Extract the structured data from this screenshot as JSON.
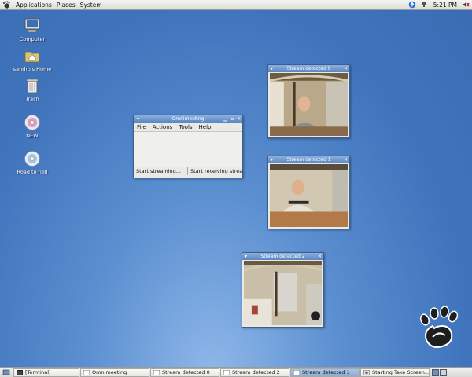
{
  "top_panel": {
    "menus": [
      "Applications",
      "Places",
      "System"
    ],
    "clock": "5:21 PM"
  },
  "desktop_icons": [
    {
      "label": "Computer"
    },
    {
      "label": "sandro's Home"
    },
    {
      "label": "Trash"
    },
    {
      "label": "NEW"
    },
    {
      "label": "Road to hell"
    }
  ],
  "omnimeeting": {
    "title": "Omnimeeting",
    "menus": [
      "File",
      "Actions",
      "Tools",
      "Help"
    ],
    "status_left": "Start streaming...",
    "status_right": "Start receiving stream"
  },
  "streams": [
    {
      "title": "Stream detected 0"
    },
    {
      "title": "Stream detected 1"
    },
    {
      "title": "Stream detected 2"
    }
  ],
  "taskbar": {
    "items": [
      {
        "label": "[Terminal]",
        "active": false
      },
      {
        "label": "Omnimeeting",
        "active": false
      },
      {
        "label": "Stream detected 0",
        "active": false
      },
      {
        "label": "Stream detected 2",
        "active": false
      },
      {
        "label": "Stream detected 1",
        "active": true
      },
      {
        "label": "Starting Take Screen...",
        "active": false
      }
    ]
  },
  "colors": {
    "desktop": "#3f74bd",
    "titlebar": "#5a86c2",
    "panel": "#dcdcd8"
  }
}
